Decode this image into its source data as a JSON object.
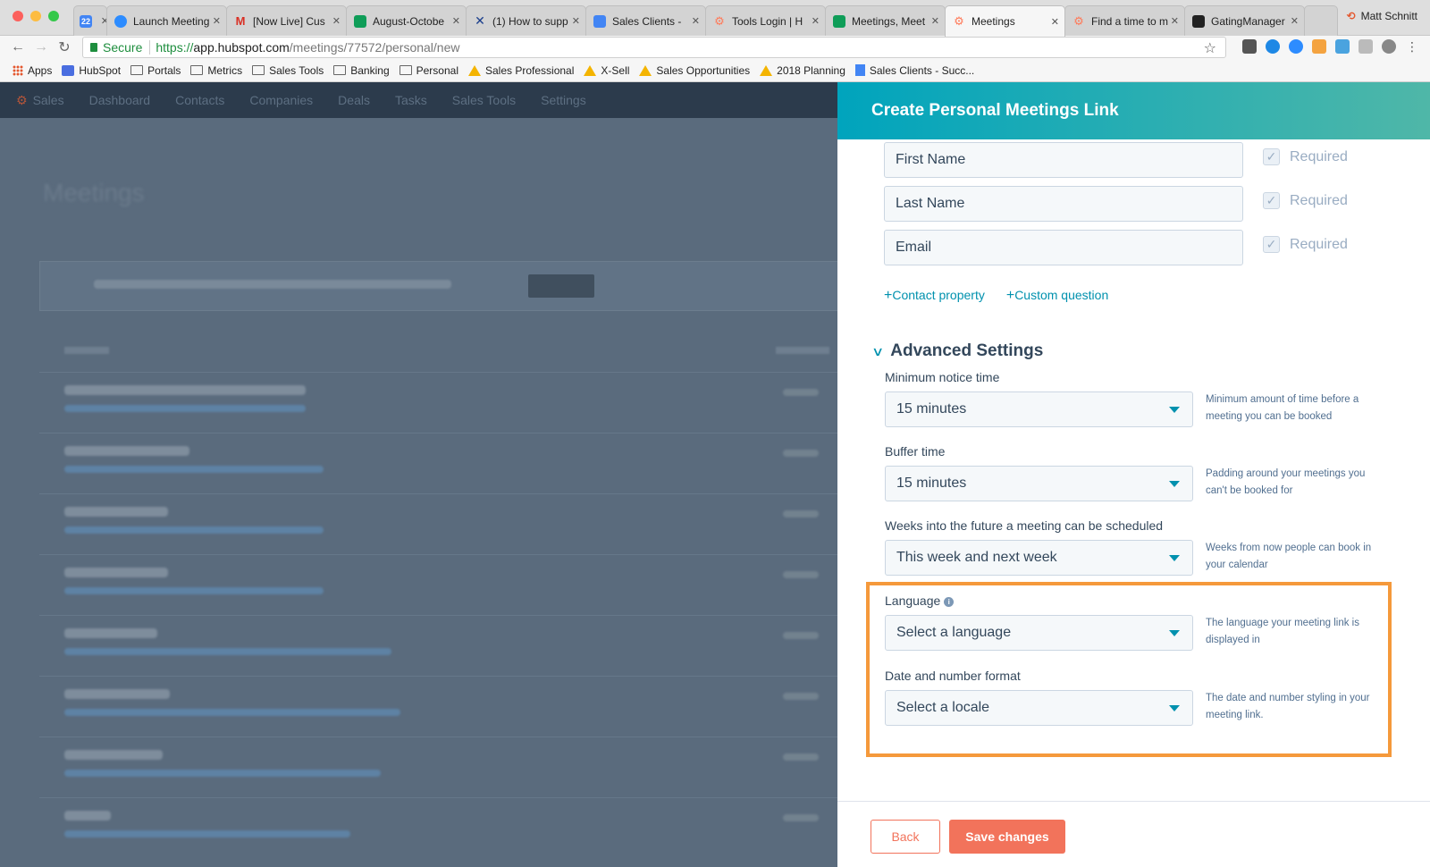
{
  "browser": {
    "tabs": [
      {
        "label": "",
        "icon": "calendar-icon",
        "color": "#4285f4"
      },
      {
        "label": "Launch Meeting",
        "icon": "zoom-icon",
        "color": "#2d8cff"
      },
      {
        "label": "[Now Live] Cus",
        "icon": "gmail-icon",
        "color": "#d93025"
      },
      {
        "label": "August-Octobe",
        "icon": "sheets-icon",
        "color": "#0f9d58"
      },
      {
        "label": "(1) How to supp",
        "icon": "x-icon",
        "color": "#1a3e8c"
      },
      {
        "label": "Sales Clients -",
        "icon": "docs-icon",
        "color": "#4285f4"
      },
      {
        "label": "Tools Login | H",
        "icon": "hubspot-icon",
        "color": "#ff7a59"
      },
      {
        "label": "Meetings, Meet",
        "icon": "sheets-icon",
        "color": "#0f9d58"
      },
      {
        "label": "Meetings",
        "icon": "hubspot-icon",
        "color": "#ff7a59",
        "active": true
      },
      {
        "label": "Find a time to m",
        "icon": "hubspot-icon",
        "color": "#ff7a59"
      },
      {
        "label": "GatingManager",
        "icon": "lock-icon",
        "color": "#222222"
      }
    ],
    "calendar_day": "22",
    "profile_name": "Matt Schnitt",
    "url_secure": "Secure",
    "url_scheme": "https://",
    "url_host": "app.hubspot.com",
    "url_path": "/meetings/77572/personal/new",
    "bookmarks": [
      "Apps",
      "HubSpot",
      "Portals",
      "Metrics",
      "Sales Tools",
      "Banking",
      "Personal",
      "Sales Professional",
      "X-Sell",
      "Sales Opportunities",
      "2018 Planning",
      "Sales Clients - Succ..."
    ]
  },
  "bg_app": {
    "nav": [
      "Sales",
      "Dashboard",
      "Contacts",
      "Companies",
      "Deals",
      "Tasks",
      "Sales Tools",
      "Settings"
    ],
    "title": "Meetings"
  },
  "panel": {
    "title": "Create Personal Meetings Link",
    "form_fields": [
      {
        "label": "First Name",
        "required_label": "Required"
      },
      {
        "label": "Last Name",
        "required_label": "Required"
      },
      {
        "label": "Email",
        "required_label": "Required"
      }
    ],
    "add_contact_property": "Contact property",
    "add_custom_question": "Custom question",
    "advanced_title": "Advanced Settings",
    "settings": {
      "min_notice": {
        "label": "Minimum notice time",
        "value": "15 minutes",
        "help": "Minimum amount of time before a meeting you can be booked"
      },
      "buffer": {
        "label": "Buffer time",
        "value": "15 minutes",
        "help": "Padding around your meetings you can't be booked for"
      },
      "weeks": {
        "label": "Weeks into the future a meeting can be scheduled",
        "value": "This week and next week",
        "help": "Weeks from now people can book in your calendar"
      },
      "language": {
        "label": "Language",
        "value": "Select a language",
        "help": "The language your meeting link is displayed in"
      },
      "date_format": {
        "label": "Date and number format",
        "value": "Select a locale",
        "help": "The date and number styling in your meeting link."
      }
    },
    "back_label": "Back",
    "save_label": "Save changes"
  },
  "colors": {
    "accent": "#0091ae",
    "header_gradient_start": "#00a4bd",
    "header_gradient_end": "#4fb7a8",
    "button": "#f2735b",
    "highlight": "#f5993b"
  }
}
